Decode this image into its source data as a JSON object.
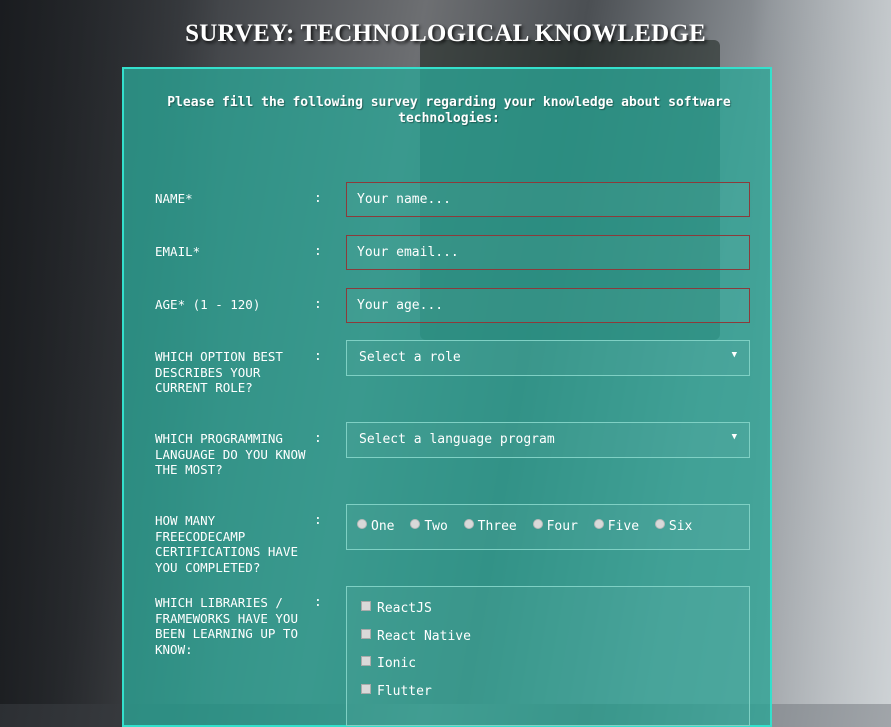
{
  "title": "SURVEY: TECHNOLOGICAL KNOWLEDGE",
  "intro": "Please fill the following survey regarding your knowledge about software technologies:",
  "colon": ":",
  "fields": {
    "name": {
      "label": "NAME*",
      "placeholder": "Your name..."
    },
    "email": {
      "label": "EMAIL*",
      "placeholder": "Your email..."
    },
    "age": {
      "label": "AGE* (1 - 120)",
      "placeholder": "Your age..."
    },
    "role": {
      "label": "WHICH OPTION BEST DESCRIBES YOUR CURRENT ROLE?",
      "selected": "Select a role"
    },
    "language": {
      "label": "WHICH PROGRAMMING LANGUAGE DO YOU KNOW THE MOST?",
      "selected": "Select a language program"
    },
    "certifications": {
      "label": "HOW MANY FREECODECAMP CERTIFICATIONS HAVE YOU COMPLETED?",
      "options": [
        "One",
        "Two",
        "Three",
        "Four",
        "Five",
        "Six"
      ]
    },
    "libraries": {
      "label": "WHICH LIBRARIES / FRAMEWORKS HAVE YOU BEEN LEARNING UP TO KNOW:",
      "options": [
        "ReactJS",
        "React Native",
        "Ionic",
        "Flutter"
      ]
    }
  },
  "colors": {
    "panel": "#2ba596",
    "panel_border": "#34e0cc",
    "input_border": "#8b3b3b",
    "select_border": "#7fd0c4"
  },
  "icons": {
    "dropdown": "triangle-down-icon"
  }
}
